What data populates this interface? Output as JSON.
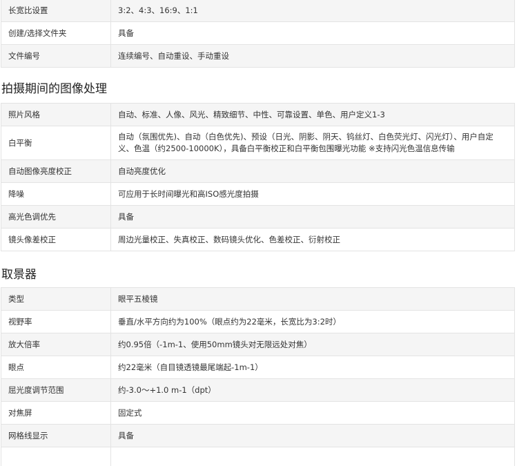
{
  "top_rows": [
    {
      "label": "长宽比设置",
      "value": "3:2、4:3、16:9、1:1"
    },
    {
      "label": "创建/选择文件夹",
      "value": "具备"
    },
    {
      "label": "文件编号",
      "value": "连续编号、自动重设、手动重设"
    }
  ],
  "sections": [
    {
      "title": "拍摄期间的图像处理",
      "rows": [
        {
          "label": "照片风格",
          "value": "自动、标准、人像、风光、精致细节、中性、可靠设置、单色、用户定义1-3"
        },
        {
          "label": "白平衡",
          "value": "自动（氛围优先)、自动（白色优先)、预设（日光、阴影、阴天、钨丝灯、白色荧光灯、闪光灯）、用户自定义、色温（约2500-10000K），具备白平衡校正和白平衡包围曝光功能 ※支持闪光色温信息传输"
        },
        {
          "label": "自动图像亮度校正",
          "value": "自动亮度优化"
        },
        {
          "label": "降噪",
          "value": "可应用于长时间曝光和高ISO感光度拍摄"
        },
        {
          "label": "高光色调优先",
          "value": "具备"
        },
        {
          "label": "镜头像差校正",
          "value": "周边光量校正、失真校正、数码镜头优化、色差校正、衍射校正"
        }
      ]
    },
    {
      "title": "取景器",
      "rows": [
        {
          "label": "类型",
          "value": "眼平五棱镜"
        },
        {
          "label": "视野率",
          "value": "垂直/水平方向约为100%（眼点约为22毫米，长宽比为3:2时）"
        },
        {
          "label": "放大倍率",
          "value": "约0.95倍（-1m-1、使用50mm镜头对无限远处对焦）"
        },
        {
          "label": "眼点",
          "value": "约22毫米（自目镜透镜最尾端起-1m-1）"
        },
        {
          "label": "屈光度调节范围",
          "value": "约-3.0～+1.0 m-1（dpt）"
        },
        {
          "label": "对焦屏",
          "value": "固定式"
        },
        {
          "label": "网格线显示",
          "value": "具备"
        },
        {
          "label": "",
          "value": ""
        }
      ]
    }
  ]
}
